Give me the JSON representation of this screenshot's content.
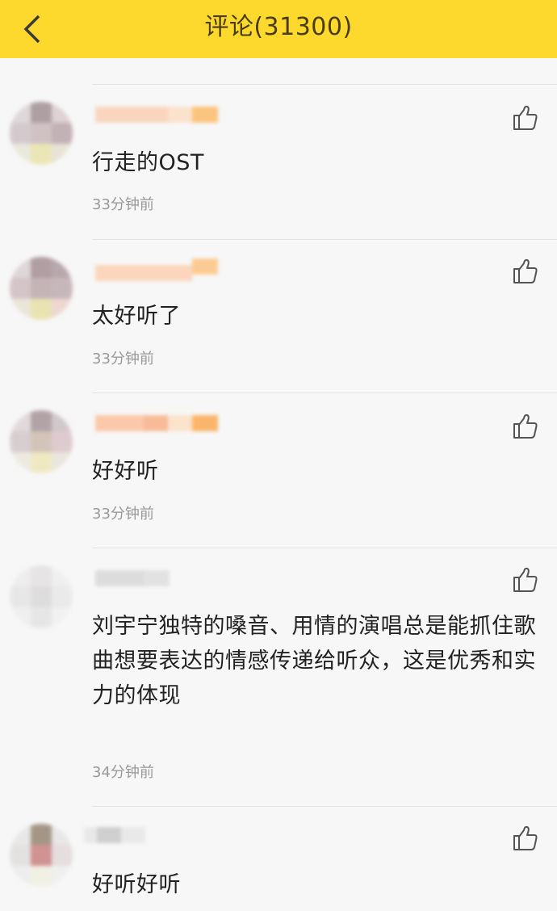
{
  "header": {
    "title": "评论(31300)",
    "back_icon": "chevron-left-icon",
    "background": "#fed92d"
  },
  "comments": [
    {
      "text": "行走的OST",
      "time": "33分钟前",
      "like_icon": "thumbs-up-icon"
    },
    {
      "text": "太好听了",
      "time": "33分钟前",
      "like_icon": "thumbs-up-icon"
    },
    {
      "text": "好好听",
      "time": "33分钟前",
      "like_icon": "thumbs-up-icon"
    },
    {
      "text": "刘宇宁独特的嗓音、用情的演唱总是能抓住歌曲想要表达的情感传递给听众，这是优秀和实力的体现",
      "time": "34分钟前",
      "like_icon": "thumbs-up-icon"
    },
    {
      "text": "好听好听",
      "time": "",
      "like_icon": "thumbs-up-icon"
    }
  ]
}
